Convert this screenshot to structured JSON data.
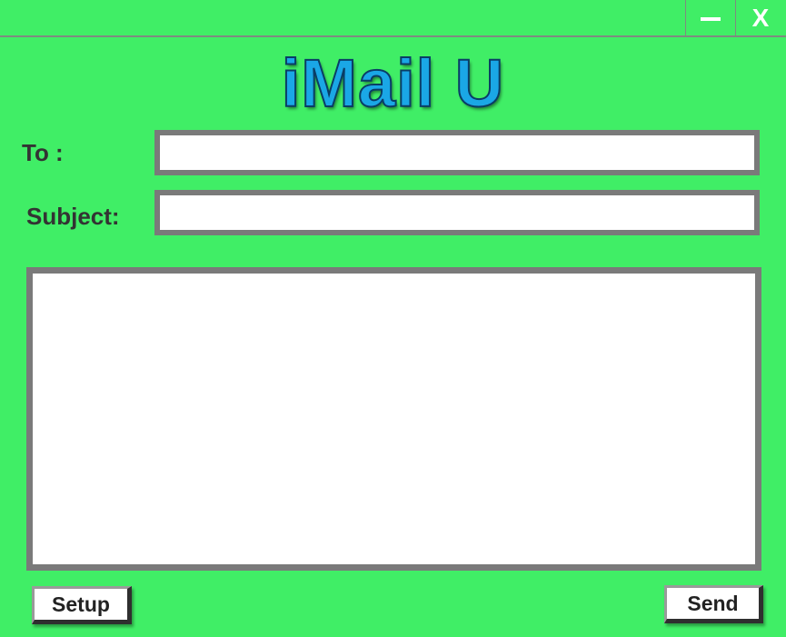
{
  "window": {
    "minimize_icon": "minimize-icon",
    "close_label": "X"
  },
  "app": {
    "logo_text": "iMail U",
    "logo_color": "#1aa7e6",
    "background_color": "#40ee66"
  },
  "form": {
    "to_label": "To :",
    "to_value": "",
    "subject_label": "Subject:",
    "subject_value": "",
    "body_value": ""
  },
  "buttons": {
    "setup_label": "Setup",
    "send_label": "Send"
  }
}
